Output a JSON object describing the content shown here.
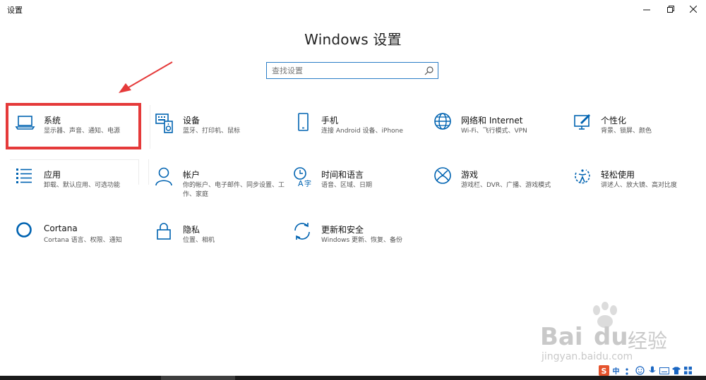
{
  "window": {
    "app_title": "设置",
    "minimize_label": "Minimize",
    "maximize_label": "Restore",
    "close_label": "Close"
  },
  "header": {
    "title": "Windows 设置"
  },
  "search": {
    "placeholder": "查找设置",
    "value": ""
  },
  "tiles": [
    {
      "title": "系统",
      "desc": "显示器、声音、通知、电源",
      "icon": "laptop-icon"
    },
    {
      "title": "设备",
      "desc": "蓝牙、打印机、鼠标",
      "icon": "keyboard-icon"
    },
    {
      "title": "手机",
      "desc": "连接 Android 设备、iPhone",
      "icon": "phone-icon"
    },
    {
      "title": "网络和 Internet",
      "desc": "Wi-Fi、飞行模式、VPN",
      "icon": "globe-icon"
    },
    {
      "title": "个性化",
      "desc": "背景、锁屏、颜色",
      "icon": "paint-icon"
    },
    {
      "title": "应用",
      "desc": "卸载、默认应用、可选功能",
      "icon": "apps-list-icon"
    },
    {
      "title": "帐户",
      "desc": "你的帐户、电子邮件、同步设置、工作、家庭",
      "icon": "person-icon"
    },
    {
      "title": "时间和语言",
      "desc": "语音、区域、日期",
      "icon": "time-language-icon"
    },
    {
      "title": "游戏",
      "desc": "游戏栏、DVR、广播、游戏模式",
      "icon": "xbox-icon"
    },
    {
      "title": "轻松使用",
      "desc": "讲述人、放大镜、高对比度",
      "icon": "ease-of-access-icon"
    },
    {
      "title": "Cortana",
      "desc": "Cortana 语言、权限、通知",
      "icon": "cortana-icon"
    },
    {
      "title": "隐私",
      "desc": "位置、相机",
      "icon": "lock-icon"
    },
    {
      "title": "更新和安全",
      "desc": "Windows 更新、恢复、备份",
      "icon": "sync-icon"
    }
  ],
  "watermark": {
    "brand": "Bai",
    "brand2": "du",
    "brand3": "经验",
    "url": "jingyan.baidu.com"
  },
  "tray": {
    "ime_label": "中"
  },
  "colors": {
    "accent": "#0063b1",
    "highlight": "#e53a3a",
    "search_border": "#2a7dc7"
  }
}
